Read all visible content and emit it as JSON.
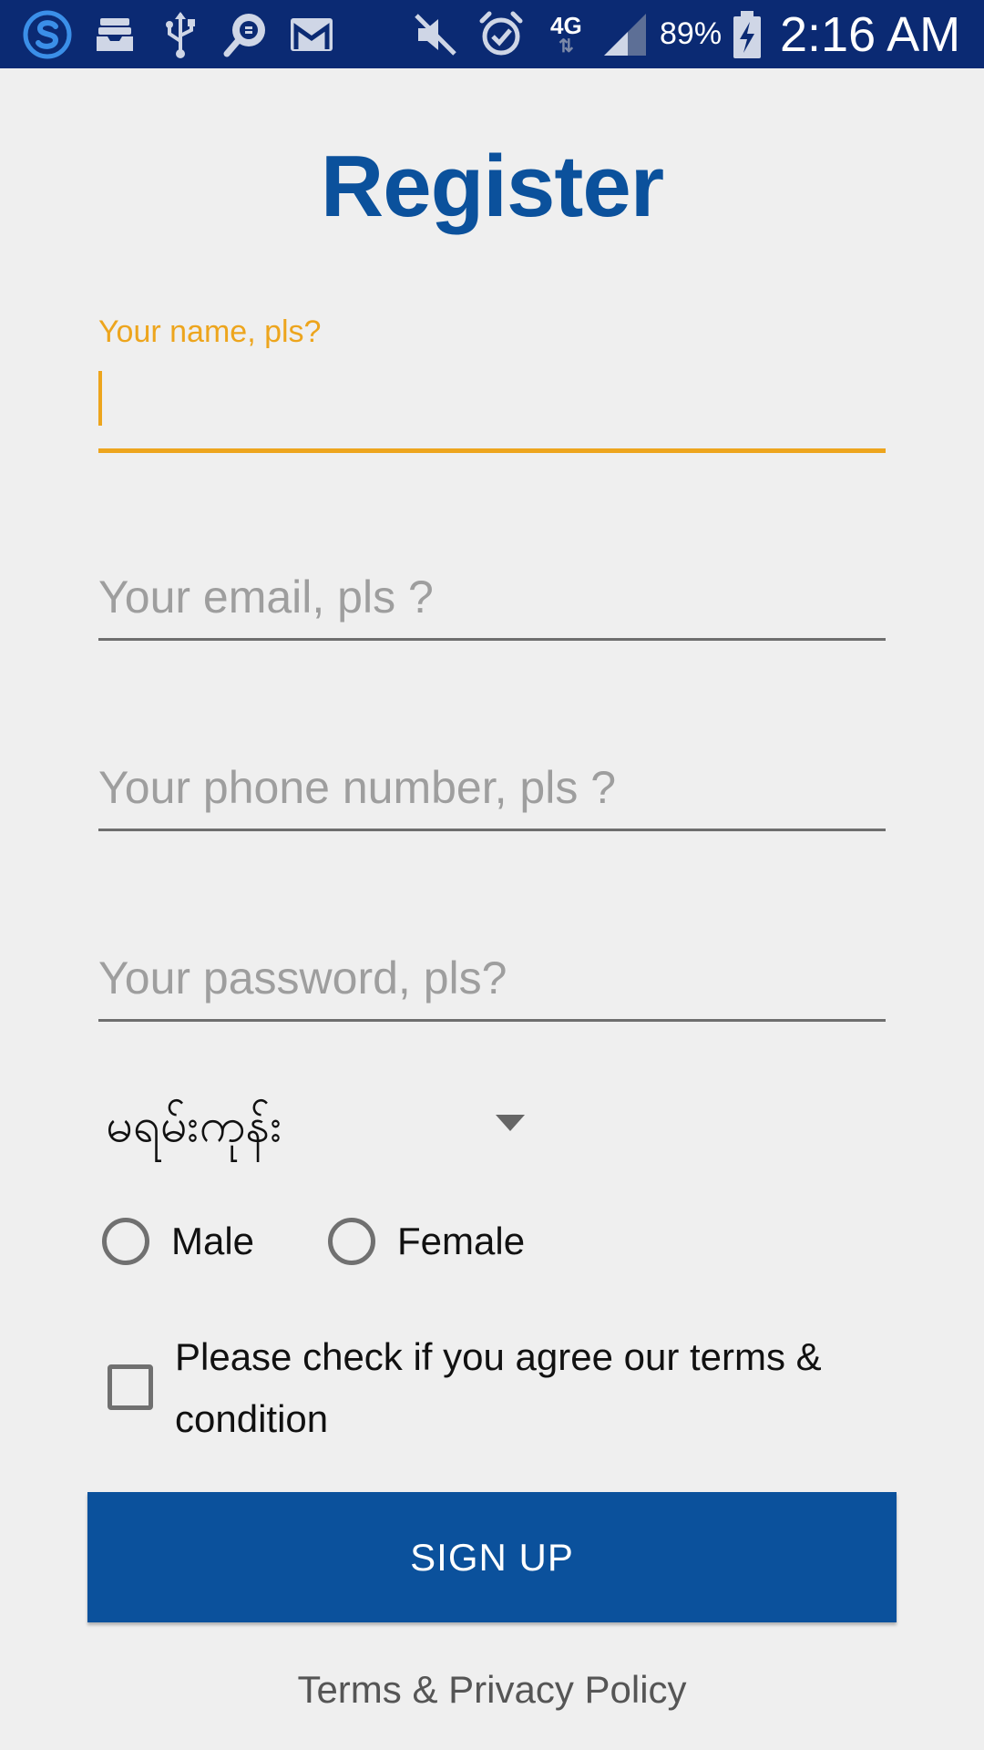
{
  "status_bar": {
    "time": "2:16 AM",
    "battery_percent": "89%",
    "network": "4G",
    "background_color": "#0b2a73",
    "icons": [
      "skype-icon",
      "inbox-tray-icon",
      "usb-icon",
      "chat-search-icon",
      "gmail-icon",
      "mute-icon",
      "alarm-icon",
      "network-4g-icon",
      "signal-icon",
      "battery-charging-icon"
    ]
  },
  "page": {
    "title": "Register",
    "title_color": "#0b519c"
  },
  "form": {
    "name": {
      "label": "Your name, pls?",
      "value": "",
      "focused": true,
      "accent_color": "#eda51d"
    },
    "email": {
      "placeholder": "Your email, pls ?",
      "value": ""
    },
    "phone": {
      "placeholder": "Your phone number, pls ?",
      "value": ""
    },
    "password": {
      "placeholder": "Your password, pls?",
      "value": ""
    },
    "region_select": {
      "selected": "မရမ်းကုန်း"
    },
    "gender": {
      "options": [
        "Male",
        "Female"
      ],
      "selected": null
    },
    "terms_checkbox": {
      "label": "Please check if you agree our terms & condition",
      "checked": false
    },
    "submit_label": "SIGN UP",
    "submit_color": "#0b519c"
  },
  "footer": {
    "terms_link": "Terms & Privacy Policy"
  }
}
